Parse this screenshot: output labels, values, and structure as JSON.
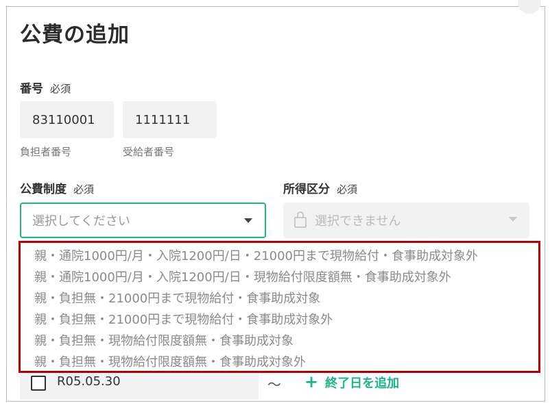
{
  "title": "公費の追加",
  "number_section": {
    "label": "番号",
    "required": "必須",
    "payer_number": "83110001",
    "payer_label": "負担者番号",
    "recipient_number": "1111111",
    "recipient_label": "受給者番号"
  },
  "public_system": {
    "label": "公費制度",
    "required": "必須",
    "placeholder": "選択してください"
  },
  "income_category": {
    "label": "所得区分",
    "required": "必須",
    "placeholder": "選択できません"
  },
  "dropdown_options": [
    "親・通院1000円/月・入院1200円/日・21000円まで現物給付・食事助成対象外",
    "親・通院1000円/月・入院1200円/日・現物給付限度額無・食事助成対象外",
    "親・負担無・21000円まで現物給付・食事助成対象",
    "親・負担無・21000円まで現物給付・食事助成対象外",
    "親・負担無・現物給付限度額無・食事助成対象",
    "親・負担無・現物給付限度額無・食事助成対象外"
  ],
  "period": {
    "start_date": "R05.05.30",
    "separator": "〜",
    "add_end_label": "終了日を追加",
    "add_icon": "plus-icon"
  },
  "colors": {
    "accent": "#1bb58b",
    "highlight_border": "#b00000"
  }
}
